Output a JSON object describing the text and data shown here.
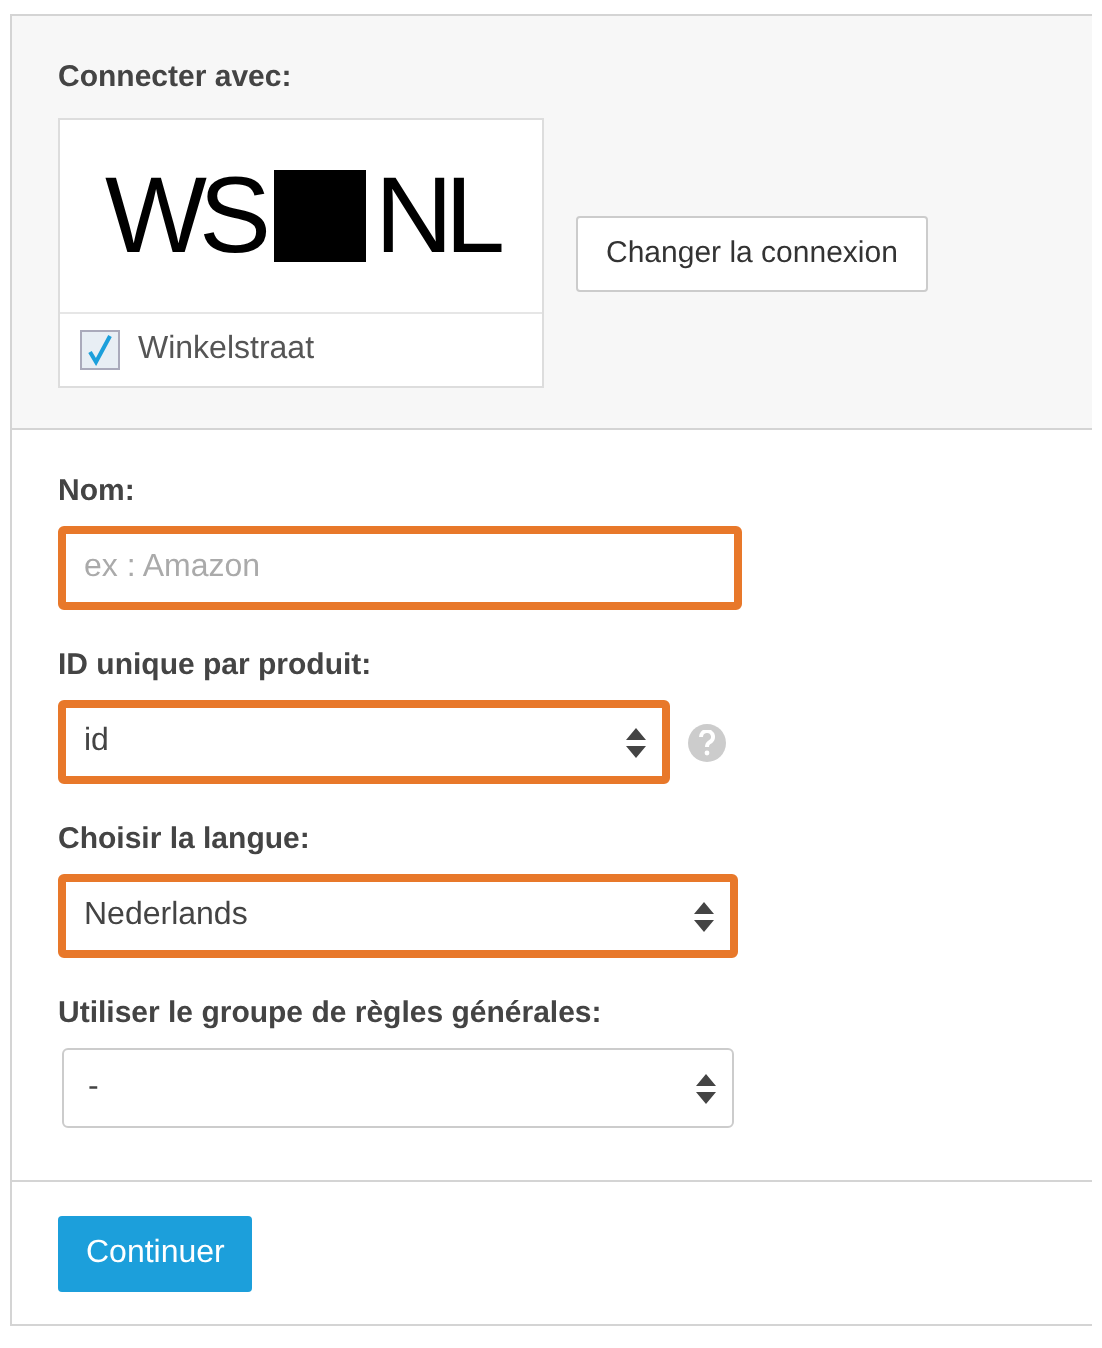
{
  "connection": {
    "label": "Connecter avec:",
    "logo": {
      "left": "WS",
      "right": "NL"
    },
    "shop": {
      "name": "Winkelstraat",
      "checked": true
    },
    "change_button": "Changer la connexion"
  },
  "fields": [
    {
      "kind": "input",
      "label": "Nom:",
      "placeholder": "ex : Amazon",
      "highlighted": true,
      "help": false
    },
    {
      "kind": "select",
      "label": "ID unique par produit:",
      "value": "id",
      "highlighted": true,
      "help": true
    },
    {
      "kind": "select",
      "label": "Choisir la langue:",
      "value": "Nederlands",
      "highlighted": true,
      "help": false
    },
    {
      "kind": "select",
      "label": "Utiliser le groupe de règles générales:",
      "value": "-",
      "highlighted": false,
      "help": false
    }
  ],
  "submit_button": "Continuer"
}
